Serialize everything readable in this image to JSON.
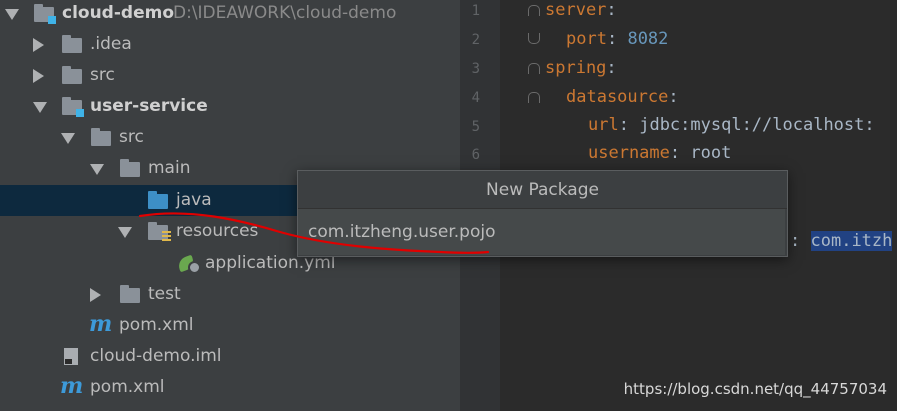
{
  "tree": {
    "project_name": "cloud-demo",
    "project_path": "D:\\IDEAWORK\\cloud-demo",
    "idea": ".idea",
    "src_root": "src",
    "module_name": "user-service",
    "module_src": "src",
    "main": "main",
    "java": "java",
    "resources": "resources",
    "app_yml": "application.yml",
    "test": "test",
    "module_pom": "pom.xml",
    "iml": "cloud-demo.iml",
    "root_pom": "pom.xml"
  },
  "editor": {
    "line_numbers": [
      "1",
      "2",
      "3",
      "4",
      "5",
      "6"
    ],
    "l1_key": "server",
    "l2_key": "port",
    "l2_val": "8082",
    "l3_key": "spring",
    "l4_key": "datasource",
    "l5_key": "url",
    "l5_val": "jdbc:mysql://localhost:",
    "l6_key": "username",
    "l6_val": "root",
    "colon": ":",
    "highlight_text": "com.itzh"
  },
  "dialog": {
    "title": "New Package",
    "input_value": "com.itzheng.user.pojo"
  },
  "watermark": "https://blog.csdn.net/qq_44757034",
  "colors": {
    "selection": "#0d293e",
    "folder_blue": "#3d8fc6",
    "keyword": "#cc7832",
    "number": "#6897bb",
    "annotation_line": "#e00000"
  }
}
